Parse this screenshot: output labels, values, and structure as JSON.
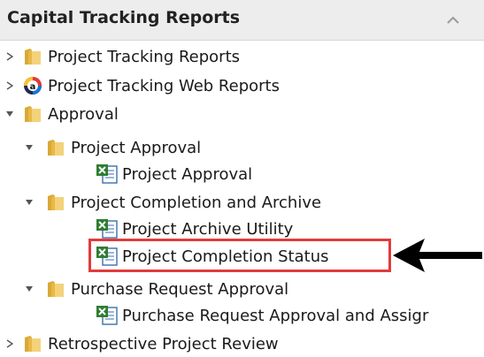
{
  "panel": {
    "title": "Capital Tracking Reports"
  },
  "tree": {
    "project_tracking_reports": "Project Tracking Reports",
    "project_tracking_web_reports": "Project Tracking Web Reports",
    "approval": "Approval",
    "project_approval_folder": "Project Approval",
    "project_approval_report": "Project Approval",
    "project_completion_archive_folder": "Project Completion and Archive",
    "project_archive_utility": "Project Archive Utility",
    "project_completion_status": "Project Completion Status",
    "purchase_request_approval_folder": "Purchase Request Approval",
    "purchase_request_approval_report": "Purchase Request Approval and Assigr",
    "retrospective_project_review": "Retrospective Project Review"
  },
  "icons": {
    "folder": "folder-icon",
    "excel": "excel-report-icon",
    "web": "web-report-icon"
  },
  "colors": {
    "highlight": "#e23b3b",
    "folder": "#e8c45a",
    "excel": "#2e7d32"
  }
}
